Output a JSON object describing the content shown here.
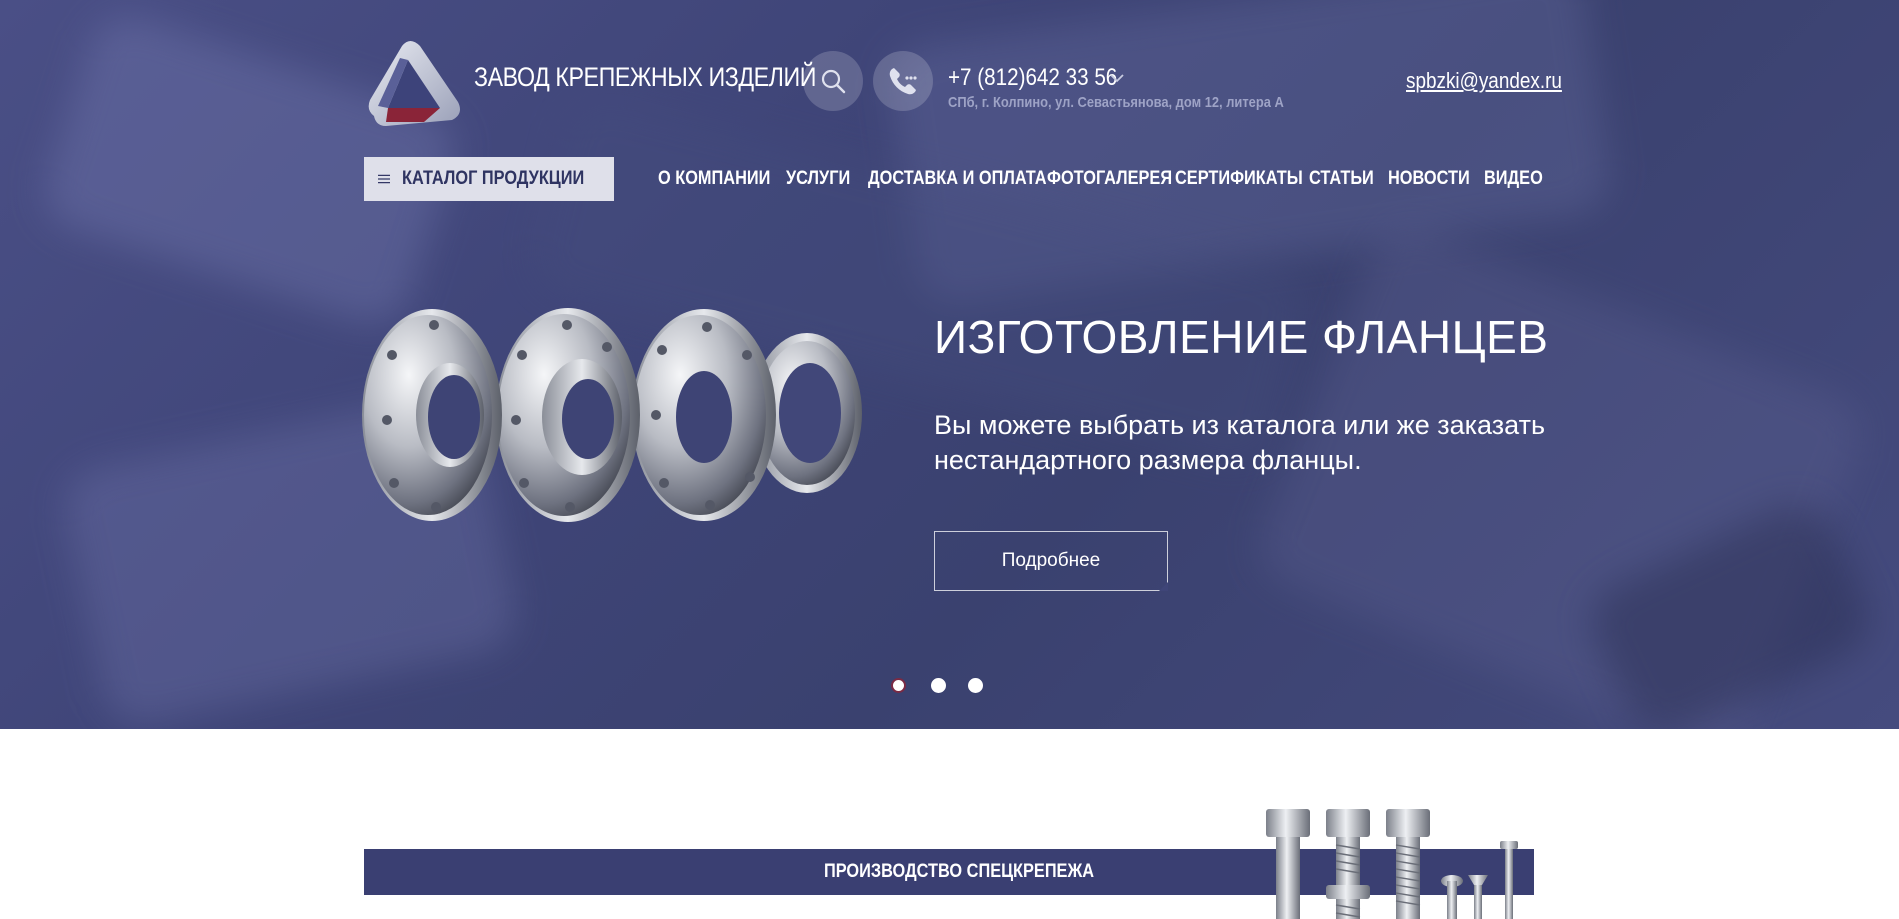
{
  "header": {
    "brand": "ЗАВОД КРЕПЕЖНЫХ ИЗДЕЛИЙ",
    "phone": "+7 (812)642 33 56",
    "address": "СПб, г. Колпино, ул. Севастьянова, дом 12, литера А",
    "email": "spbzki@yandex.ru"
  },
  "nav": {
    "catalog_label": "КАТАЛОГ ПРОДУКЦИИ",
    "items": [
      "О КОМПАНИИ",
      "УСЛУГИ",
      "ДОСТАВКА И ОПЛАТА",
      "ФОТОГАЛЕРЕЯ",
      "СЕРТИФИКАТЫ",
      "СТАТЬИ",
      "НОВОСТИ",
      "ВИДЕО"
    ]
  },
  "slide": {
    "title": "ИЗГОТОВЛЕНИЕ ФЛАНЦЕВ",
    "text": "Вы можете выбрать из каталога или же заказать нестандартного размера фланцы.",
    "button": "Подробнее",
    "dots": 3,
    "active_dot": 1
  },
  "section": {
    "title": "ПРОИЗВОДСТВО СПЕЦКРЕПЕЖА"
  },
  "colors": {
    "hero_bg": "#3f4578",
    "band": "#3a3f72",
    "catalog_bg": "#dfe0ea",
    "catalog_text": "#2f3462",
    "logo_red": "#8a2438"
  },
  "icons": [
    "logo-icon",
    "search-icon",
    "phone-icon",
    "chevron-down-icon",
    "menu-icon"
  ]
}
